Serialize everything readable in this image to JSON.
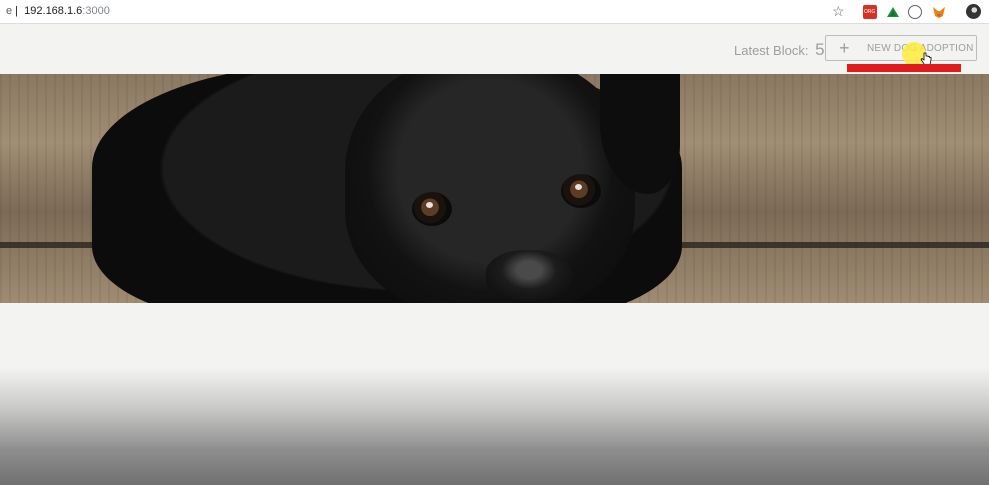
{
  "browser": {
    "url_scheme": "e",
    "url_host": "192.168.1.6",
    "url_port": ":3000",
    "icons": [
      "star-icon",
      "org-extension-icon",
      "triangle-extension-icon",
      "circle-extension-icon",
      "fox-extension-icon",
      "profile-avatar"
    ]
  },
  "header": {
    "latest_block_label": "Latest Block:",
    "latest_block_value": "5",
    "new_button_label": "NEW DOG ADOPTION",
    "plus_icon": "+"
  },
  "colors": {
    "background": "#f3f3f1",
    "annotation_red": "#e01b1b",
    "cursor_highlight": "#ffeb3b",
    "muted_text": "#9e9e9e"
  }
}
